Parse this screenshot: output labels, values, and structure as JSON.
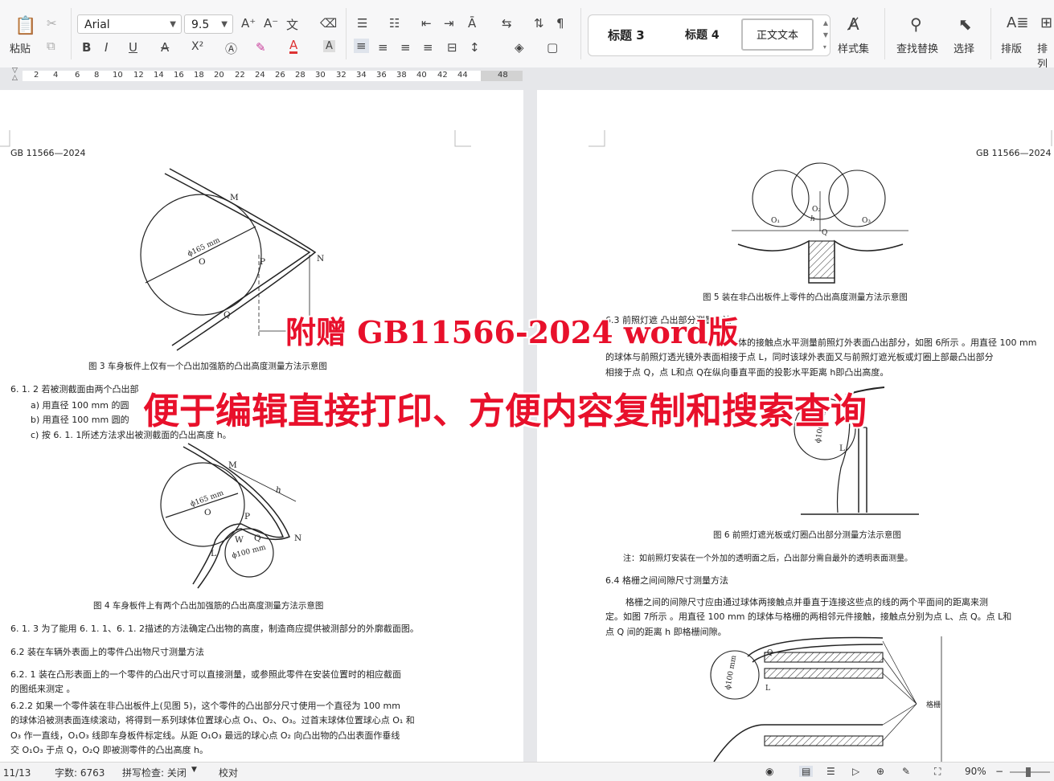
{
  "ribbon": {
    "paste_label": "粘贴",
    "font_name": "Arial",
    "font_size": "9.5",
    "styles": [
      "标题 3",
      "标题 4",
      "正文文本"
    ],
    "style_set_label": "样式集",
    "find_replace_label": "查找替换",
    "select_label": "选择",
    "layout_label": "排版",
    "arrange_label": "排列",
    "bold": "B",
    "italic": "I",
    "underline": "U",
    "strike": "A",
    "superscript": "X²",
    "font_color": "A"
  },
  "ruler": {
    "ticks": [
      "2",
      "4",
      "6",
      "8",
      "10",
      "12",
      "14",
      "16",
      "18",
      "20",
      "22",
      "24",
      "26",
      "28",
      "30",
      "32",
      "34",
      "36",
      "38",
      "40",
      "42",
      "44",
      "48"
    ]
  },
  "left_page": {
    "header": "GB 11566—2024",
    "fig3_caption": "图 3   车身板件上仅有一个凸出加强筋的凸出高度测量方法示意图",
    "fig3_labels": {
      "m": "M",
      "o": "O",
      "p": "P",
      "n": "N",
      "q": "Q",
      "d": "ϕ165 mm"
    },
    "p612": "6. 1. 2   若被测截面由两个凸出部",
    "list_a": "a)   用直径 100 mm 的圆",
    "list_b": "b)   用直径 100 mm 圆的",
    "list_c": "c)   按 6. 1. 1所述方法求出被测截面的凸出高度 h。",
    "fig4_caption": "图 4   车身板件上有两个凸出加强筋的凸出高度测量方法示意图",
    "fig4_labels": {
      "m": "M",
      "o": "O",
      "p": "P",
      "n": "N",
      "q": "Q",
      "w": "W",
      "l": "L",
      "h": "h",
      "d1": "ϕ165 mm",
      "d2": "ϕ100 mm"
    },
    "p613": "6. 1. 3   为了能用 6. 1. 1、6. 1. 2描述的方法确定凸出物的高度，制造商应提供被测部分的外廓截面图。",
    "h62": "6.2   装在车辆外表面上的零件凸出物尺寸测量方法",
    "p621_1": "6.2. 1   装在凸形表面上的一个零件的凸出尺寸可以直接测量，或参照此零件在安装位置时的相应截面",
    "p621_2": "的图纸来测定 。",
    "p622_1": "6.2.2   如果一个零件装在非凸出板件上(见图 5)，这个零件的凸出部分尺寸使用一个直径为  100 mm",
    "p622_2": "的球体沿被测表面连续滚动，将得到一系列球体位置球心点 O₁、O₂、O₃。过首末球体位置球心点 O₁ 和",
    "p622_3": "O₃ 作一直线，O₁O₃ 线即车身板件标定线。从距 O₁O₃ 最远的球心点 O₂ 向凸出物的凸出表面作垂线",
    "p622_4": "交 O₁O₃ 于点 Q，O₂Q 即被测零件的凸出高度 h。"
  },
  "right_page": {
    "header": "GB 11566—2024",
    "fig5_caption": "图 5   装在非凸出板件上零件的凸出高度测量方法示意图",
    "fig5_labels": {
      "o1": "O₁",
      "o2": "O₂",
      "o3": "O₃",
      "h": "h",
      "q": "Q"
    },
    "h63": "6.3   前照灯遮          凸出部分测量方法",
    "p63_1": "体的接触点水平测量前照灯外表面凸出部分，如图 6所示 。用直径 100 mm",
    "p63_2": "的球体与前照灯透光镜外表面相接于点 L，同时该球外表面又与前照灯遮光板或灯圈上部最凸出部分",
    "p63_3": "相接于点 Q，点 L和点 Q在纵向垂直平面的投影水平距离 h即凸出高度。",
    "fig6_labels": {
      "d": "ϕ100 mm",
      "l": "L"
    },
    "fig6_caption": "图 6   前照灯遮光板或灯圈凸出部分测量方法示意图",
    "note": "注：如前照灯安装在一个外加的透明面之后，凸出部分需自最外的透明表面测量。",
    "h64": "6.4   格栅之间间隙尺寸测量方法",
    "p64_1": "格栅之间的间隙尺寸应由通过球体两接触点并垂直于连接这些点的线的两个平面间的距离来测",
    "p64_2": "定。如图 7所示 。用直径  100 mm 的球体与格栅的两相邻元件接触，接触点分别为点 L、点 Q。点 L和",
    "p64_3": "点 Q 间的距离 h 即格栅间隙。",
    "fig7_labels": {
      "q": "Q",
      "l": "L",
      "d": "ϕ100 mm",
      "grid": "格栅"
    }
  },
  "overlay": {
    "line1": "附赠 GB11566-2024 word版",
    "line2": "便于编辑直接打印、方便内容复制和搜索查询"
  },
  "status": {
    "page": "页: 11/13",
    "words": "字数: 6763",
    "spell": "拼写检查: 关闭",
    "proof": "校对",
    "zoom": "90%"
  },
  "colors": {
    "overlay_red": "#e8102b",
    "accent_blue": "#2b6cd6"
  }
}
